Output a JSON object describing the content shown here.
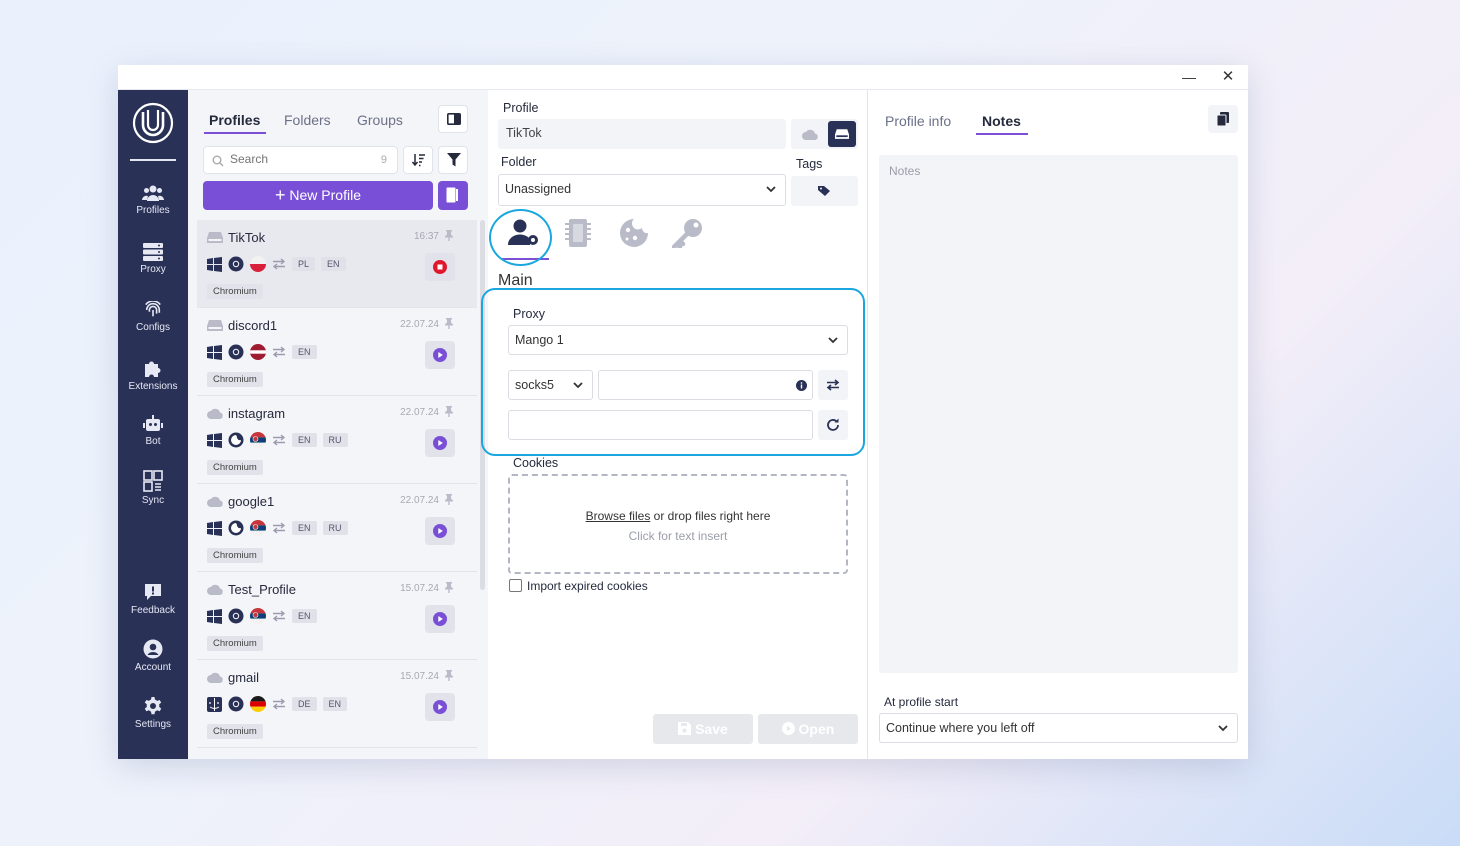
{
  "window": {
    "minimize_glyph": "—",
    "close_glyph": "✕"
  },
  "rail": {
    "items": [
      {
        "label": "Profiles",
        "icon": "users-icon"
      },
      {
        "label": "Proxy",
        "icon": "server-icon"
      },
      {
        "label": "Configs",
        "icon": "fingerprint-icon"
      },
      {
        "label": "Extensions",
        "icon": "puzzle-icon"
      },
      {
        "label": "Bot",
        "icon": "robot-icon"
      },
      {
        "label": "Sync",
        "icon": "sync-icon"
      },
      {
        "label": "Feedback",
        "icon": "feedback-icon"
      },
      {
        "label": "Account",
        "icon": "account-icon"
      },
      {
        "label": "Settings",
        "icon": "gear-icon"
      }
    ]
  },
  "list": {
    "tabs": [
      "Profiles",
      "Folders",
      "Groups"
    ],
    "search_placeholder": "Search",
    "search_count": "9",
    "new_profile_label": "New Profile",
    "profiles": [
      {
        "name": "TikTok",
        "date": "16:37",
        "langs": [
          "PL",
          "EN"
        ],
        "browser": "Chromium",
        "running": true
      },
      {
        "name": "discord1",
        "date": "22.07.24",
        "langs": [
          "EN"
        ],
        "browser": "Chromium",
        "running": false
      },
      {
        "name": "instagram",
        "date": "22.07.24",
        "langs": [
          "EN",
          "RU"
        ],
        "browser": "Chromium",
        "running": false
      },
      {
        "name": "google1",
        "date": "22.07.24",
        "langs": [
          "EN",
          "RU"
        ],
        "browser": "Chromium",
        "running": false
      },
      {
        "name": "Test_Profile",
        "date": "15.07.24",
        "langs": [
          "EN"
        ],
        "browser": "Chromium",
        "running": false
      },
      {
        "name": "gmail",
        "date": "15.07.24",
        "langs": [
          "DE",
          "EN"
        ],
        "browser": "Chromium",
        "running": false
      }
    ]
  },
  "editor": {
    "profile_label": "Profile",
    "profile_value": "TikTok",
    "folder_label": "Folder",
    "folder_value": "Unassigned",
    "tags_label": "Tags",
    "main_heading": "Main",
    "proxy_label": "Proxy",
    "proxy_value": "Mango 1",
    "proxy_type": "socks5",
    "cookies_label": "Cookies",
    "browse_link": "Browse files",
    "drop_text": " or drop files right here",
    "click_insert": "Click for text insert",
    "import_expired": "Import expired cookies",
    "save_label": "Save",
    "open_label": "Open"
  },
  "right": {
    "tabs": [
      "Profile info",
      "Notes"
    ],
    "active_tab": "Notes",
    "notes_placeholder": "Notes",
    "at_start_label": "At profile start",
    "at_start_value": "Continue where you left off"
  },
  "colors": {
    "accent": "#7a4fd8",
    "rail": "#2a3157",
    "highlight": "#1aa7e0",
    "stop": "#e0182d"
  }
}
